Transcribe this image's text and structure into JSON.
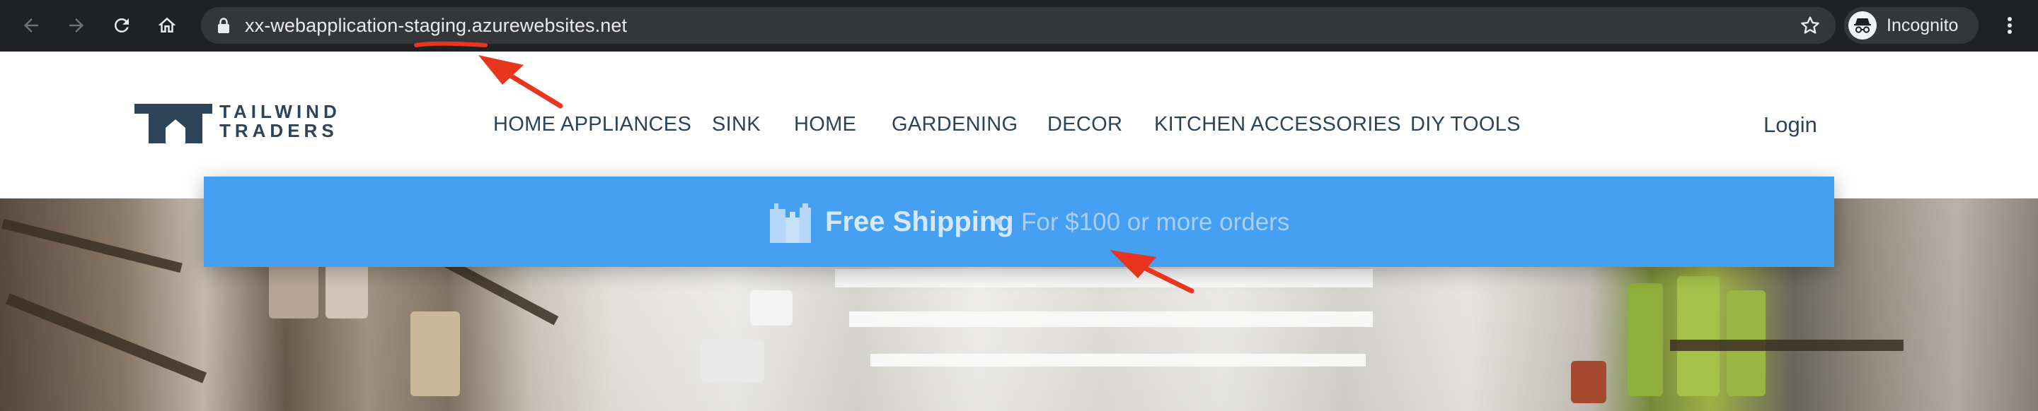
{
  "browser": {
    "url": "xx-webapplication-staging.azurewebsites.net",
    "incognito_label": "Incognito",
    "icons": [
      "back-arrow-icon",
      "forward-arrow-icon",
      "reload-icon",
      "home-icon",
      "lock-icon",
      "star-icon",
      "incognito-icon",
      "more-menu-icon"
    ]
  },
  "site": {
    "logo": {
      "line1": "TAILWIND",
      "line2": "TRADERS"
    },
    "nav": [
      {
        "label": "HOME APPLIANCES"
      },
      {
        "label": "SINK"
      },
      {
        "label": "HOME"
      },
      {
        "label": "GARDENING"
      },
      {
        "label": "DECOR"
      },
      {
        "label": "KITCHEN ACCESSORIES"
      },
      {
        "label": "DIY TOOLS"
      }
    ],
    "login_label": "Login"
  },
  "shipping_banner": {
    "title": "Free Shipping",
    "separator": "•",
    "subtitle": "For $100 or more orders",
    "icon": "shipping-boxes-icon"
  },
  "colors": {
    "chrome_bg": "#202124",
    "omnibox_bg": "#35363a",
    "brand_navy": "#2d4358",
    "banner_blue": "#459ff2",
    "annotation_red": "#e8361e"
  }
}
